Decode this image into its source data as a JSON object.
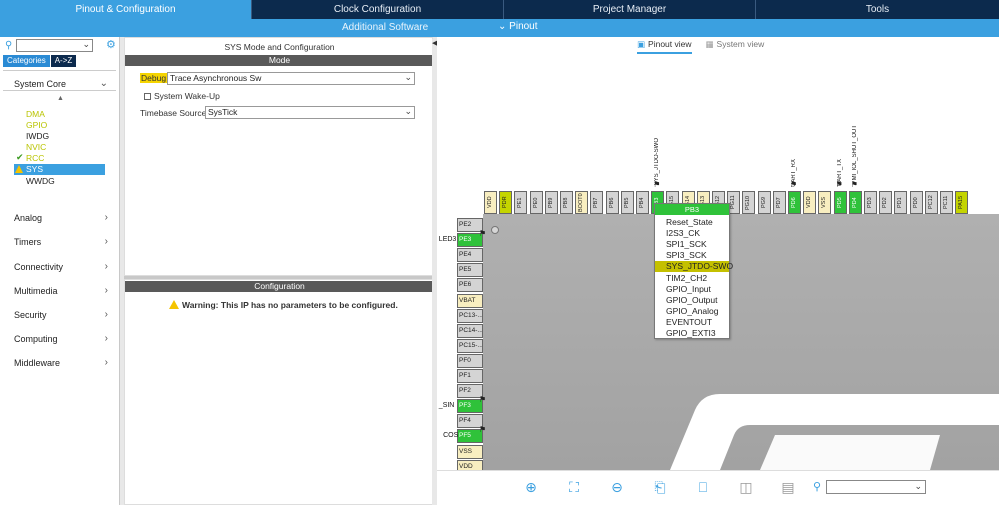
{
  "top_tabs": [
    "Pinout & Configuration",
    "Clock Configuration",
    "Project Manager",
    "Tools"
  ],
  "sub_bar": {
    "additional_software": "Additional Software",
    "pinout": "Pinout"
  },
  "sidebar": {
    "tabs": [
      "Categories",
      "A->Z"
    ],
    "system_core": "System Core",
    "system_core_items": [
      "DMA",
      "GPIO",
      "IWDG",
      "NVIC",
      "RCC",
      "SYS",
      "WWDG"
    ],
    "categories": [
      "Analog",
      "Timers",
      "Connectivity",
      "Multimedia",
      "Security",
      "Computing",
      "Middleware"
    ]
  },
  "mid": {
    "title": "SYS Mode and Configuration",
    "mode_header": "Mode",
    "debug_label": "Debug",
    "debug_value": "Trace Asynchronous Sw",
    "system_wakeup": "System Wake-Up",
    "timebase_label": "Timebase Source",
    "timebase_value": "SysTick",
    "config_header": "Configuration",
    "warning": "Warning: This IP has no parameters to be configured."
  },
  "view_tabs": {
    "pinout_view": "Pinout view",
    "system_view": "System view"
  },
  "top_pins": [
    "VDD",
    "PDR",
    "PE1",
    "PE0",
    "PB9",
    "PB8",
    "BOOT0",
    "PB7",
    "PB6",
    "PB5",
    "PB4",
    "PB3",
    "PG15",
    "PG14",
    "PG13",
    "PG12",
    "PG11",
    "PG10",
    "PG9",
    "PD7",
    "PD6",
    "VDD",
    "VSS",
    "PD5",
    "PD4",
    "PD3",
    "PD2",
    "PD1",
    "PD0",
    "PC12",
    "PC11",
    "PA15"
  ],
  "top_pin_labels": {
    "PB3": "SYS_JTDO-SWO",
    "PD6": "UART_RX",
    "PD5": "UART_TX",
    "PD4": "MI_IOL_SHUT_OUT"
  },
  "left_pins": [
    "PE2",
    "PE3",
    "PE4",
    "PE5",
    "PE6",
    "VBAT",
    "PC13-...",
    "PC14-...",
    "PC15-...",
    "PF0",
    "PF1",
    "PF2",
    "PF3",
    "PF4",
    "PF5",
    "VSS",
    "VDD"
  ],
  "left_pin_labels": {
    "PE3": "LED3",
    "PF3": "_SIN",
    "PF5": "COS"
  },
  "popup": {
    "header": "PB3",
    "items": [
      "Reset_State",
      "I2S3_CK",
      "SPI1_SCK",
      "SPI3_SCK",
      "SYS_JTDO-SWO",
      "TIM2_CH2",
      "GPIO_Input",
      "GPIO_Output",
      "GPIO_Analog",
      "EVENTOUT",
      "GPIO_EXTI3"
    ],
    "selected": "SYS_JTDO-SWO"
  },
  "colors": {
    "accent": "#3ba0e0",
    "navy": "#0c2a4d",
    "pin_green": "#2fc23a",
    "pin_yellow": "#f8eec0",
    "highlight": "#c4c000"
  }
}
